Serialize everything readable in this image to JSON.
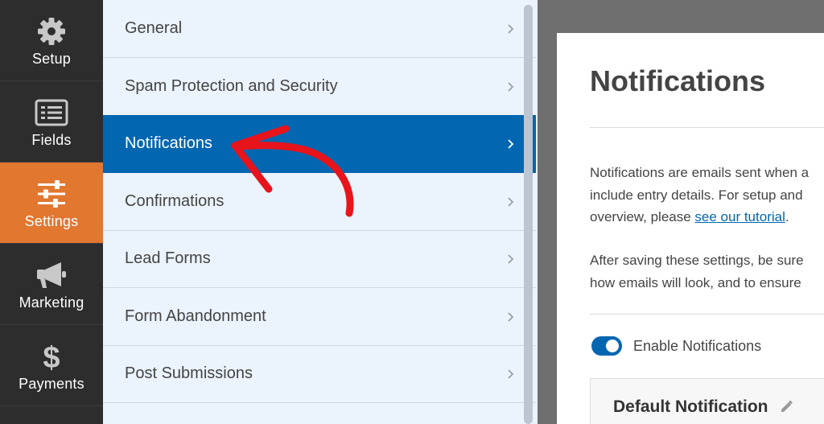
{
  "sidebar": {
    "items": [
      {
        "label": "Setup",
        "icon": "gear-icon"
      },
      {
        "label": "Fields",
        "icon": "fields-list-icon"
      },
      {
        "label": "Settings",
        "icon": "sliders-icon",
        "active": true
      },
      {
        "label": "Marketing",
        "icon": "megaphone-icon"
      },
      {
        "label": "Payments",
        "icon": "dollar-icon"
      }
    ]
  },
  "settings_panel": {
    "items": [
      {
        "label": "General"
      },
      {
        "label": "Spam Protection and Security"
      },
      {
        "label": "Notifications",
        "active": true
      },
      {
        "label": "Confirmations"
      },
      {
        "label": "Lead Forms"
      },
      {
        "label": "Form Abandonment"
      },
      {
        "label": "Post Submissions"
      }
    ]
  },
  "main": {
    "title": "Notifications",
    "intro": {
      "line1": "Notifications are emails sent when a",
      "line2": "include entry details. For setup and",
      "line3_pre": "overview, please ",
      "link": "see our tutorial",
      "line3_post": "."
    },
    "note": {
      "line1": "After saving these settings, be sure",
      "line2": "how emails will look, and to ensure"
    },
    "toggle": {
      "label": "Enable Notifications",
      "on": true
    },
    "notification_card": {
      "title": "Default Notification"
    }
  },
  "colors": {
    "sidebar_bg": "#2d2d2d",
    "sidebar_active": "#e27730",
    "panel_bg": "#ebf3fc",
    "panel_active": "#0366b0",
    "annotation_arrow": "#e8141c"
  }
}
